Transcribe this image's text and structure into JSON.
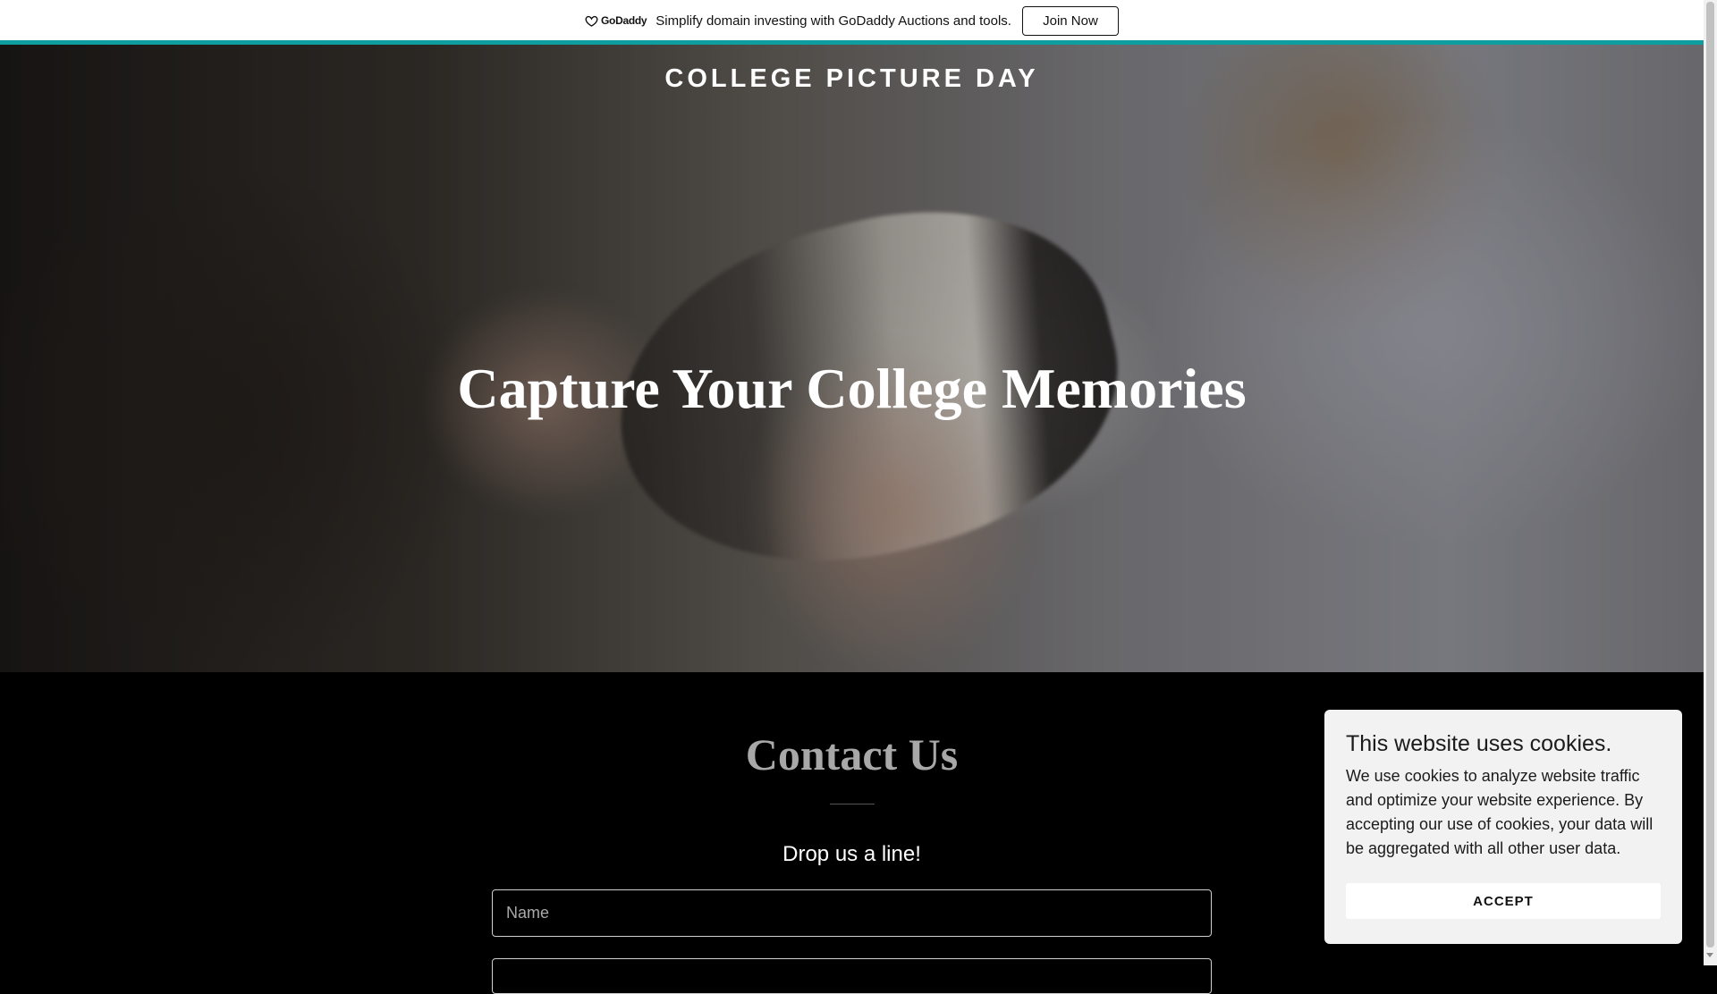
{
  "promo": {
    "logo_text": "GoDaddy",
    "message": "Simplify domain investing with GoDaddy Auctions and tools.",
    "join_label": "Join Now",
    "accent_color": "#0f9ea0"
  },
  "hero": {
    "site_title": "COLLEGE PICTURE DAY",
    "headline": "Capture Your College Memories"
  },
  "contact": {
    "title": "Contact Us",
    "subtitle": "Drop us a line!",
    "name_placeholder": "Name"
  },
  "cookie": {
    "title": "This website uses cookies.",
    "text": "We use cookies to analyze website traffic and optimize your website experience. By accepting our use of cookies, your data will be aggregated with all other user data.",
    "accept_label": "ACCEPT"
  }
}
